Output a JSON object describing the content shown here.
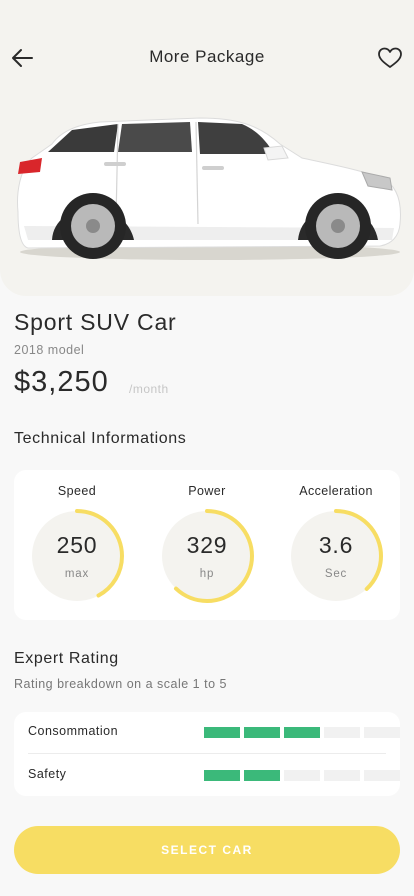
{
  "header": {
    "title": "More Package",
    "back_icon": "arrow-left-icon",
    "favorite_icon": "heart-outline-icon"
  },
  "product": {
    "name": "Sport SUV Car",
    "model": "2018 model",
    "price": "$3,250",
    "price_period": "/month",
    "image": "white-suv-car"
  },
  "technical": {
    "title": "Technical Informations",
    "gauges": [
      {
        "label": "Speed",
        "value": "250",
        "unit": "max",
        "fill": 0.42
      },
      {
        "label": "Power",
        "value": "329",
        "unit": "hp",
        "fill": 0.62
      },
      {
        "label": "Acceleration",
        "value": "3.6",
        "unit": "Sec",
        "fill": 0.38
      }
    ]
  },
  "rating": {
    "title": "Expert Rating",
    "subtitle": "Rating breakdown on a scale 1 to 5",
    "rows": [
      {
        "label": "Consommation",
        "score": 3,
        "max": 5
      },
      {
        "label": "Safety",
        "score": 2,
        "max": 5
      }
    ]
  },
  "cta": {
    "label": "SELECT CAR"
  },
  "colors": {
    "accent": "#f7dd63",
    "rating_on": "#3bb97a",
    "rating_off": "#f1f1f1",
    "gauge_track": "#f4f3ef",
    "hero_bg": "#f4f3ef"
  }
}
